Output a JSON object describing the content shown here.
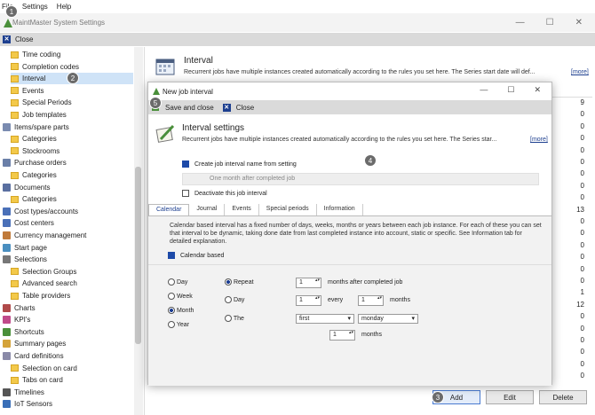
{
  "menu": {
    "file": "File",
    "settings": "Settings",
    "help": "Help"
  },
  "window": {
    "title": "MaintMaster System Settings",
    "close_label": "Close"
  },
  "sidebar": [
    {
      "label": "Time coding",
      "indent": 1,
      "icon": "folder-icon"
    },
    {
      "label": "Completion codes",
      "indent": 1,
      "icon": "folder-icon"
    },
    {
      "label": "Interval",
      "indent": 1,
      "icon": "folder-icon",
      "selected": true
    },
    {
      "label": "Events",
      "indent": 1,
      "icon": "folder-icon"
    },
    {
      "label": "Special Periods",
      "indent": 1,
      "icon": "folder-icon"
    },
    {
      "label": "Job templates",
      "indent": 1,
      "icon": "folder-icon"
    },
    {
      "label": "Items/spare parts",
      "indent": 0,
      "icon": "tools-icon"
    },
    {
      "label": "Categories",
      "indent": 1,
      "icon": "folder-icon"
    },
    {
      "label": "Stockrooms",
      "indent": 1,
      "icon": "folder-icon"
    },
    {
      "label": "Purchase orders",
      "indent": 0,
      "icon": "cart-icon"
    },
    {
      "label": "Categories",
      "indent": 1,
      "icon": "folder-icon"
    },
    {
      "label": "Documents",
      "indent": 0,
      "icon": "documents-icon"
    },
    {
      "label": "Categories",
      "indent": 1,
      "icon": "folder-icon"
    },
    {
      "label": "Cost types/accounts",
      "indent": 0,
      "icon": "cost-icon"
    },
    {
      "label": "Cost centers",
      "indent": 0,
      "icon": "cost-icon"
    },
    {
      "label": "Currency management",
      "indent": 0,
      "icon": "currency-icon"
    },
    {
      "label": "Start page",
      "indent": 0,
      "icon": "startpage-icon"
    },
    {
      "label": "Selections",
      "indent": 0,
      "icon": "selections-icon"
    },
    {
      "label": "Selection Groups",
      "indent": 1,
      "icon": "folder-icon"
    },
    {
      "label": "Advanced search",
      "indent": 1,
      "icon": "folder-icon"
    },
    {
      "label": "Table providers",
      "indent": 1,
      "icon": "folder-icon"
    },
    {
      "label": "Charts",
      "indent": 0,
      "icon": "chart-icon"
    },
    {
      "label": "KPI's",
      "indent": 0,
      "icon": "kpi-icon"
    },
    {
      "label": "Shortcuts",
      "indent": 0,
      "icon": "shortcuts-icon"
    },
    {
      "label": "Summary pages",
      "indent": 0,
      "icon": "summary-icon"
    },
    {
      "label": "Card definitions",
      "indent": 0,
      "icon": "card-icon"
    },
    {
      "label": "Selection on card",
      "indent": 1,
      "icon": "folder-icon"
    },
    {
      "label": "Tabs on card",
      "indent": 1,
      "icon": "folder-icon"
    },
    {
      "label": "Timelines",
      "indent": 0,
      "icon": "timeline-icon"
    },
    {
      "label": "IoT Sensors",
      "indent": 0,
      "icon": "iot-icon"
    }
  ],
  "main": {
    "title": "Interval",
    "description": "Recurrent jobs have multiple instances created automatically according to the rules you set here. The Series start date will def...",
    "more": "[more]",
    "counts": [
      "9",
      "0",
      "0",
      "0",
      "0",
      "0",
      "0",
      "0",
      "0",
      "13",
      "0",
      "0",
      "0",
      "0",
      "0",
      "0",
      "1",
      "12",
      "0",
      "0",
      "0",
      "0",
      "0",
      "0"
    ],
    "buttons": {
      "add": "Add",
      "edit": "Edit",
      "delete": "Delete"
    }
  },
  "dialog": {
    "title": "New job interval",
    "save_close": "Save and close",
    "close": "Close",
    "heading": "Interval settings",
    "description": "Recurrent jobs have multiple instances created automatically according to the rules you set here. The Series star...",
    "more": "[more]",
    "create_name_label": "Create job interval name from setting",
    "name_value": "One month after completed job",
    "deactivate_label": "Deactivate this job interval",
    "tabs": [
      "Calendar",
      "Journal",
      "Events",
      "Special periods",
      "Information"
    ],
    "calendar_text": "Calendar based interval has a fixed number of days, weeks, months or years between each job instance. For each of these you can set that interval to be dynamic, taking done date from last completed instance into account, static or specific. See Information tab for detailed explanation.",
    "calendar_based_label": "Calendar based",
    "units": [
      "Day",
      "Week",
      "Month",
      "Year"
    ],
    "selected_unit": "Month",
    "modes": [
      "Repeat",
      "Day",
      "The"
    ],
    "selected_mode": "Repeat",
    "repeat_value": "1",
    "repeat_suffix": "months after completed job",
    "day_value": "1",
    "every_label": "every",
    "every_value": "1",
    "day_suffix": "months",
    "the_first": "first",
    "the_weekday": "monday",
    "the_months_value": "1",
    "the_months_suffix": "months"
  },
  "steps": [
    "1",
    "2",
    "3",
    "4",
    "5"
  ],
  "colors": {
    "accent": "#1d3f8f",
    "selected_bg": "#cfe3f7",
    "step": "#6b6b6b"
  }
}
